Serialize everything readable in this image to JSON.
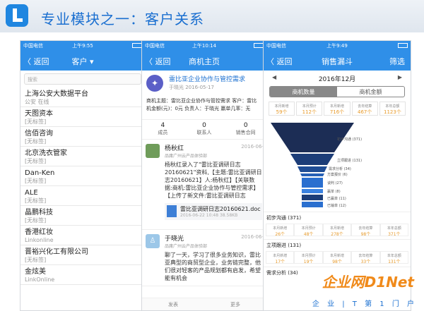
{
  "slide": {
    "title": "专业模块之一：客户关系"
  },
  "phone1": {
    "status": {
      "carrier": "中国电信",
      "time": "上午9:55"
    },
    "nav": {
      "back": "〈 返回",
      "title": "客户 ▾"
    },
    "search_placeholder": "搜索",
    "customers": [
      {
        "name": "上海公安大数据平台",
        "sub": "公安 在线"
      },
      {
        "name": "天图资本",
        "sub": "[无标签]"
      },
      {
        "name": "信佰咨询",
        "sub": "[无标签]"
      },
      {
        "name": "北京洗衣管家",
        "sub": "[无标签]"
      },
      {
        "name": "Dan-Ken",
        "sub": "[无标签]"
      },
      {
        "name": "ALE",
        "sub": "[无标签]"
      },
      {
        "name": "晶鹏科技",
        "sub": "[无标签]"
      },
      {
        "name": "香港红妆",
        "sub": "Linkonline"
      },
      {
        "name": "晋裕兴化工有限公司",
        "sub": "[无标签]"
      },
      {
        "name": "金炫美",
        "sub": "LinkOnline"
      }
    ]
  },
  "phone2": {
    "status": {
      "carrier": "中国电信",
      "time": "上午10:14"
    },
    "nav": {
      "back": "〈 返回",
      "title": "商机主页"
    },
    "opportunity": {
      "title": "雷比亚企业协作与管控需求",
      "sub": "于晓光 2016-05-17",
      "info1": "商机主题：雷比亚企业协作与管控需求  客户：雷比",
      "info2": "机金额(元)：0元  负责人：于晓光  赢单几率：无"
    },
    "stats": [
      {
        "value": "4",
        "label": "成员"
      },
      {
        "value": "0",
        "label": "联系人"
      },
      {
        "value": "0",
        "label": "销售合同"
      }
    ],
    "feed": [
      {
        "name": "杨秋红",
        "date": "2016-06-",
        "org": "品庸广州云产品体验部",
        "text": "杨秋红录入了\"雷比亚调研日志20160621\"资料,【主题:雷比亚调研日志20160621】人:杨秋红】【关联数据:商机:雷比亚企业协作与管控需求】【上传了新文件:雷比亚调研日志20160621.docx】"
      },
      {
        "name": "于晓光",
        "date": "2016-06-",
        "org": "品庸广州云产品体验部",
        "text": "聊了一天，学习了很多业务知识，雷比亚典型的商贸型企业，业务链完整，他们很对轻客的产品规划都有启发，希望能有机会"
      }
    ],
    "attachment": {
      "name": "雷比亚调研日志20160621.doc",
      "meta": "2016-06-22 10:48  38.58KB"
    },
    "footer": [
      "发表",
      "更多"
    ]
  },
  "phone3": {
    "status": {
      "carrier": "中国电信",
      "time": "上午9:49"
    },
    "nav": {
      "back": "〈 返回",
      "title": "销售漏斗",
      "right": "筛选"
    },
    "month": "2016年12月",
    "seg": [
      "商机数量",
      "商机金额"
    ],
    "top_stats": [
      {
        "label": "本月新增",
        "value": "59个"
      },
      {
        "label": "本月预计",
        "value": "112个"
      },
      {
        "label": "本月新增",
        "value": "716个"
      },
      {
        "label": "去年结算",
        "value": "467个"
      },
      {
        "label": "本年总额",
        "value": "1123个"
      }
    ],
    "funnel_labels": [
      "初步沟通 (371)",
      "立项跟进 (131)",
      "需求分析 (34)",
      "方案报价 (6)",
      "谈判 (27)",
      "赢单 (8)",
      "已赢单 (11)",
      "已输单 (12)"
    ],
    "sections": [
      {
        "title": "初步沟通 (371)",
        "cells": [
          {
            "label": "本月新增",
            "value": "26个"
          },
          {
            "label": "本月预计",
            "value": "48个"
          },
          {
            "label": "本月新增",
            "value": "278个"
          },
          {
            "label": "去年结算",
            "value": "98个"
          },
          {
            "label": "本年总额",
            "value": "371个"
          }
        ]
      },
      {
        "title": "立项跟进 (131)",
        "cells": [
          {
            "label": "本月新增",
            "value": "17个"
          },
          {
            "label": "本月预计",
            "value": "19个"
          },
          {
            "label": "本月新增",
            "value": "98个"
          },
          {
            "label": "去年结算",
            "value": "33个"
          },
          {
            "label": "本年总额",
            "value": "131个"
          }
        ]
      }
    ],
    "next_section": "需求分析 (34)"
  },
  "watermark": {
    "brand": "企业网D1Net",
    "tagline": "企 业 | T 第 1 门 户"
  }
}
